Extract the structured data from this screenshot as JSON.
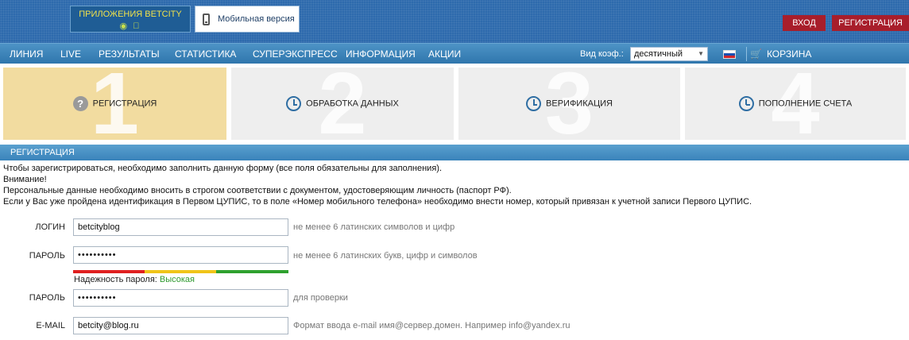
{
  "header": {
    "apps_button": "ПРИЛОЖЕНИЯ BETCITY",
    "mobile_button": "Мобильная версия",
    "login_button": "ВХОД",
    "register_button": "РЕГИСТРАЦИЯ"
  },
  "nav": {
    "items": [
      "ЛИНИЯ",
      "LIVE",
      "РЕЗУЛЬТАТЫ",
      "СТАТИСТИКА",
      "СУПЕРЭКСПРЕСС",
      "ИНФОРМАЦИЯ",
      "АКЦИИ"
    ],
    "coef_label": "Вид коэф.:",
    "coef_value": "десятичный",
    "cart": "КОРЗИНА"
  },
  "steps": [
    {
      "number": "1",
      "label": "РЕГИСТРАЦИЯ",
      "icon": "question-icon",
      "active": true
    },
    {
      "number": "2",
      "label": "ОБРАБОТКА ДАННЫХ",
      "icon": "clock-icon",
      "active": false
    },
    {
      "number": "3",
      "label": "ВЕРИФИКАЦИЯ",
      "icon": "clock-icon",
      "active": false
    },
    {
      "number": "4",
      "label": "ПОПОЛНЕНИЕ СЧЕТА",
      "icon": "clock-icon",
      "active": false
    }
  ],
  "section": {
    "title": "РЕГИСТРАЦИЯ",
    "intro": [
      "Чтобы зарегистрироваться, необходимо заполнить данную форму (все поля обязательны для заполнения).",
      "Внимание!",
      "Персональные данные необходимо вносить в строгом соответствии с документом, удостоверяющим личность (паспорт РФ).",
      "Если у Вас уже пройдена идентификация в Первом ЦУПИС, то в поле «Номер мобильного телефона» необходимо внести номер, который привязан к учетной записи Первого ЦУПИС."
    ]
  },
  "form": {
    "login": {
      "label": "ЛОГИН",
      "value": "betcityblog",
      "hint": "не менее 6 латинских символов и цифр"
    },
    "password": {
      "label": "ПАРОЛЬ",
      "value": "••••••••••",
      "hint": "не менее 6 латинских букв, цифр и символов"
    },
    "password_strength": {
      "label": "Надежность пароля:",
      "value": "Высокая"
    },
    "password_confirm": {
      "label": "ПАРОЛЬ",
      "value": "••••••••••",
      "hint": "для проверки"
    },
    "email": {
      "label": "E-MAIL",
      "value": "betcity@blog.ru",
      "hint": "Формат ввода e-mail имя@сервер.домен. Например info@yandex.ru"
    }
  },
  "colors": {
    "header_blue": "#2e6aad",
    "auth_red": "#a81e2b",
    "active_step": "#f2dca0",
    "strength_red": "#e02020",
    "strength_yellow": "#f0c419",
    "strength_green": "#2ea12e"
  }
}
